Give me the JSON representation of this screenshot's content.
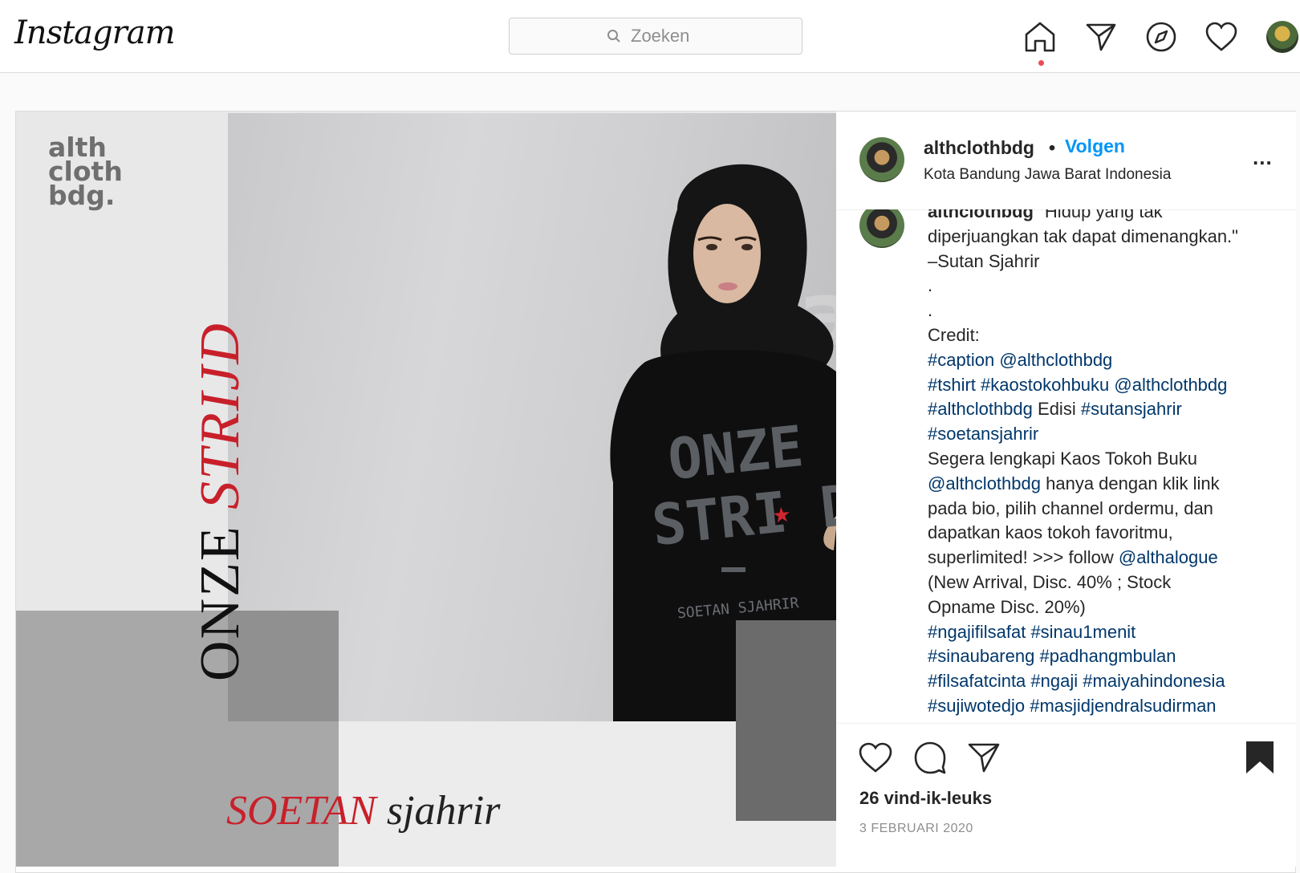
{
  "app": {
    "logo": "Instagram"
  },
  "search": {
    "placeholder": "Zoeken"
  },
  "nav": {
    "icons": [
      "home-icon",
      "direct-icon",
      "explore-icon",
      "activity-icon",
      "profile-avatar"
    ]
  },
  "colors": {
    "accent": "#0095f6",
    "hashtag": "#00376b",
    "notification": "#ed4956",
    "poster_red": "#c8202a"
  },
  "post": {
    "media": {
      "brand_line1": "alth",
      "brand_line2": "cloth",
      "brand_line3": "bdg.",
      "vertical_word1": "ONZE",
      "vertical_word2": "STRIJD",
      "footer_word1": "SOETAN",
      "footer_word2": "sjahrir",
      "shirt_line1": "ONZE",
      "shirt_line2": "STRIJD",
      "shirt_line3": "SOETAN SJAHRIR"
    },
    "author": {
      "username": "althclothbdg",
      "follow_label": "Volgen",
      "bullet": "•",
      "location": "Kota Bandung Jawa Barat Indonesia"
    },
    "caption": {
      "username": "althclothbdg",
      "l1": "\"Hidup yang tak",
      "l2": "diperjuangkan tak dapat dimenangkan.\"",
      "l3": "–Sutan Sjahrir",
      "l4": ".",
      "l5": ".",
      "l6": "Credit:",
      "t1": "#caption",
      "t2": "@althclothbdg",
      "t3": "#tshirt",
      "t4": "#kaostokohbuku",
      "t5": "@althclothbdg",
      "t6": "#althclothbdg",
      "w1": "Edisi",
      "t7": "#sutansjahrir",
      "t8": "#soetansjahrir",
      "p1": "Segera lengkapi Kaos Tokoh Buku",
      "t9": "@althclothbdg",
      "p2": "hanya dengan klik link",
      "p3": "pada bio, pilih channel ordermu, dan",
      "p4": "dapatkan kaos tokoh favoritmu,",
      "p5": "superlimited! >>> follow",
      "t10": "@althalogue",
      "p6": "(New Arrival, Disc. 40% ; Stock",
      "p7": "Opname Disc. 20%)",
      "t11": "#ngajifilsafat",
      "t12": "#sinau1menit",
      "t13": "#sinaubareng",
      "t14": "#padhangmbulan",
      "t15": "#filsafatcinta",
      "t16": "#ngaji",
      "t17": "#maiyahindonesia",
      "t18": "#sujiwotedjo",
      "t19": "#masjidjendralsudirman"
    },
    "likes": "26 vind-ik-leuks",
    "date": "3 FEBRUARI 2020",
    "more_label": "..."
  }
}
